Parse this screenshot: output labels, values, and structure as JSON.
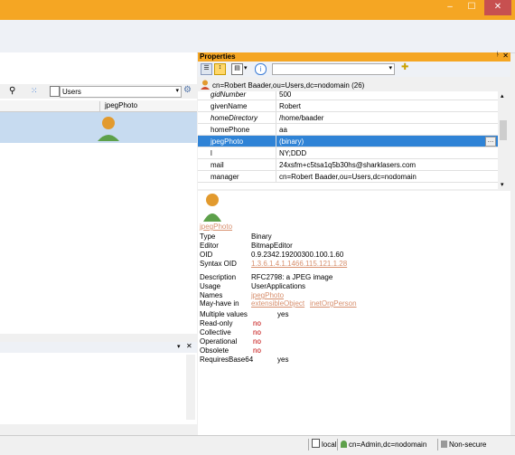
{
  "window": {
    "min": "–",
    "max": "☐",
    "close": "✕"
  },
  "left_toolbar": {
    "search_icon": "search-icon",
    "filter_icon": "filter-icon",
    "location": "Users"
  },
  "left_columns": [
    "jpegPhoto"
  ],
  "properties": {
    "title": "Properties",
    "dn": "cn=Robert Baader,ou=Users,dc=nodomain (26)",
    "attributes": [
      {
        "name": "gidNumber",
        "value": "500",
        "italic": true
      },
      {
        "name": "givenName",
        "value": "Robert",
        "italic": false
      },
      {
        "name": "homeDirectory",
        "value": "/home/baader",
        "italic": true
      },
      {
        "name": "homePhone",
        "value": "aa",
        "italic": false
      },
      {
        "name": "jpegPhoto",
        "value": "(binary)",
        "italic": false,
        "selected": true
      },
      {
        "name": "l",
        "value": "NY;DDD",
        "italic": false
      },
      {
        "name": "mail",
        "value": "24xsfm+c5tsa1q5b30hs@sharklasers.com",
        "italic": false
      },
      {
        "name": "manager",
        "value": "cn=Robert Baader,ou=Users,dc=nodomain",
        "italic": false
      }
    ],
    "info": {
      "name": "jpegPhoto",
      "rows": [
        {
          "label": "Type",
          "value": "Binary"
        },
        {
          "label": "Editor",
          "value": "BitmapEditor"
        },
        {
          "label": "OID",
          "value": "0.9.2342.19200300.100.1.60"
        },
        {
          "label": "Syntax OID",
          "value": "1.3.6.1.4.1.1466.115.121.1.28",
          "link": true
        },
        {
          "label": "Description",
          "value": "RFC2798: a JPEG image"
        },
        {
          "label": "Usage",
          "value": "UserApplications"
        },
        {
          "label": "Names",
          "value": "jpegPhoto",
          "link": true
        }
      ],
      "may_have_label": "May-have in",
      "may_have": [
        "extensibleObject",
        "inetOrgPerson"
      ],
      "flags": [
        {
          "label": "Multiple values",
          "value": "yes",
          "red": false
        },
        {
          "label": "Read-only",
          "value": "no",
          "red": true
        },
        {
          "label": "Collective",
          "value": "no",
          "red": true
        },
        {
          "label": "Operational",
          "value": "no",
          "red": true
        },
        {
          "label": "Obsolete",
          "value": "no",
          "red": true
        },
        {
          "label": "RequiresBase64",
          "value": "yes",
          "red": false
        }
      ]
    }
  },
  "status": {
    "local": "local",
    "user": "cn=Admin,dc=nodomain",
    "security": "Non-secure"
  },
  "colors": {
    "accent": "#f5a623",
    "selection": "#2f83d6",
    "link": "#d78f6d",
    "no": "#c00000"
  }
}
